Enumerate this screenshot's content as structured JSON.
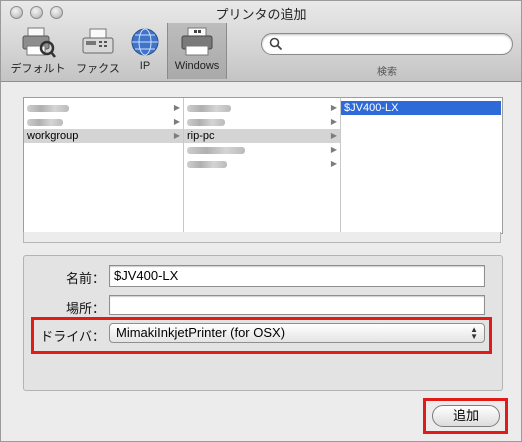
{
  "window": {
    "title": "プリンタの追加"
  },
  "toolbar": {
    "buttons": [
      {
        "label": "デフォルト",
        "icon": "default-printer-icon"
      },
      {
        "label": "ファクス",
        "icon": "fax-icon"
      },
      {
        "label": "IP",
        "icon": "globe-icon"
      },
      {
        "label": "Windows",
        "icon": "windows-printer-icon",
        "selected": true
      }
    ],
    "search": {
      "caption": "検索",
      "value": ""
    }
  },
  "browser": {
    "column1": {
      "selected": "workgroup"
    },
    "column2": {
      "selected": "rip-pc"
    },
    "column3": {
      "selected": "$JV400-LX"
    }
  },
  "form": {
    "name_label": "名前：",
    "name_value": "$JV400-LX",
    "location_label": "場所：",
    "location_value": "",
    "driver_label": "ドライバ：",
    "driver_value": "MimakiInkjetPrinter (for OSX)"
  },
  "footer": {
    "add_label": "追加"
  },
  "colors": {
    "selection": "#2e6bd8",
    "highlight_box": "#e11a1a"
  }
}
